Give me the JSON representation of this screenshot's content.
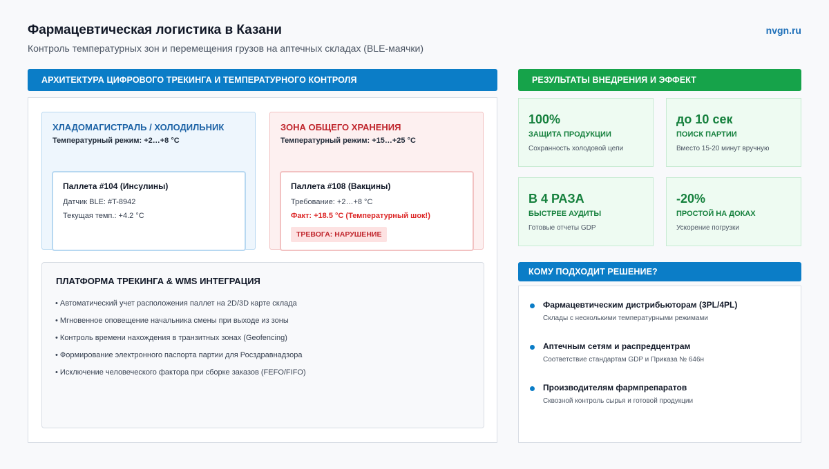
{
  "header": {
    "title": "Фармацевтическая логистика в Казани",
    "subtitle": "Контроль температурных зон и перемещения грузов на аптечных складах (BLE-маячки)",
    "site": "nvgn.ru"
  },
  "architecture": {
    "heading": "Архитектура цифрового трекинга и температурного контроля",
    "cold_zone": {
      "title": "Хладомагистраль / Холодильник",
      "mode": "Температурный режим: +2…+8 °C",
      "pallet": {
        "name": "Паллета #104 (Инсулины)",
        "line1": "Датчик BLE: #T-8942",
        "line2": "Текущая темп.: +4.2 °C"
      }
    },
    "warm_zone": {
      "title": "Зона общего хранения",
      "mode": "Температурный режим: +15…+25 °C",
      "pallet": {
        "name": "Паллета #108 (Вакцины)",
        "line1": "Требование: +2…+8 °C",
        "line2": "Факт: +18.5 °C (Температурный шок!)",
        "badge": "Тревога: нарушение"
      }
    },
    "platform": {
      "title": "Платформа трекинга & WMS интеграция",
      "items": [
        "• Автоматический учет расположения паллет на 2D/3D карте склада",
        "• Мгновенное оповещение начальника смены при выходе из зоны",
        "• Контроль времени нахождения в транзитных зонах (Geofencing)",
        "• Формирование электронного паспорта партии для Росздравнадзора",
        "• Исключение человеческого фактора при сборке заказов (FEFO/FIFO)"
      ]
    }
  },
  "results": {
    "heading": "Результаты внедрения и эффект",
    "metrics": [
      {
        "value": "100%",
        "label": "Защита продукции",
        "note": "Сохранность холодовой цепи"
      },
      {
        "value": "до 10 сек",
        "label": "Поиск партии",
        "note": "Вместо 15-20 минут вручную"
      },
      {
        "value": "В 4 РАЗА",
        "label": "Быстрее аудиты",
        "note": "Готовые отчеты GDP"
      },
      {
        "value": "-20%",
        "label": "Простой на доках",
        "note": "Ускорение погрузки"
      }
    ]
  },
  "audience": {
    "heading": "Кому подходит решение?",
    "items": [
      {
        "title": "Фармацевтическим дистрибьюторам (3PL/4PL)",
        "sub": "Склады с несколькими температурными режимами"
      },
      {
        "title": "Аптечным сетям и распредцентрам",
        "sub": "Соответствие стандартам GDP и Приказа № 646н"
      },
      {
        "title": "Производителям фармпрепаратов",
        "sub": "Сквозной контроль сырья и готовой продукции"
      }
    ]
  },
  "colors": {
    "accent_blue": "#0b7dc7",
    "accent_green": "#16a34a",
    "alert_red": "#dc2626"
  }
}
